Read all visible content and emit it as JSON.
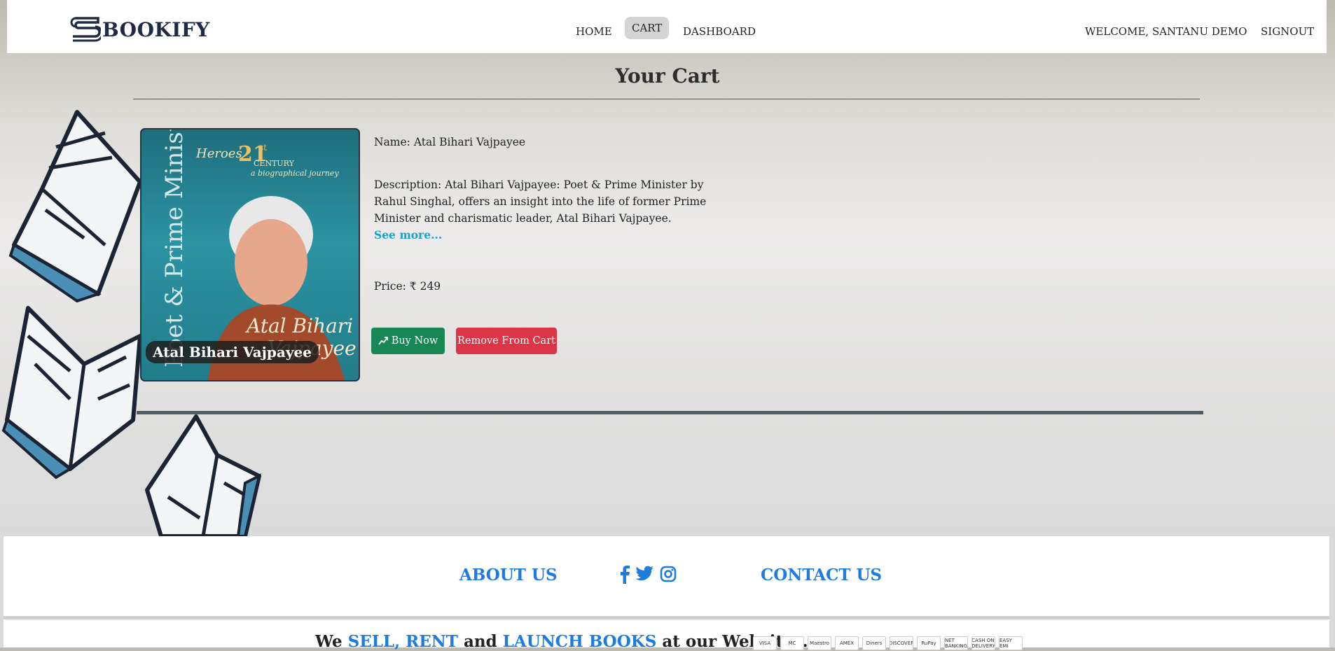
{
  "brand": {
    "name": "BOOKIFY"
  },
  "nav": {
    "home": "HOME",
    "cart": "CART",
    "dashboard": "DASHBOARD",
    "welcome": "WELCOME, SANTANU DEMO",
    "signout": "SIGNOUT"
  },
  "cart": {
    "title": "Your Cart",
    "item": {
      "cover_label": "Atal Bihari Vajpayee",
      "name_line": "Name: Atal Bihari Vajpayee",
      "description": "Description: Atal Bihari Vajpayee: Poet & Prime Minister by Rahul Singhal, offers an insight into the life of former Prime Minister and charismatic leader, Atal Bihari Vajpayee.",
      "see_more": "See more...",
      "price_line": "Price: ₹ 249",
      "buy_label": "Buy Now",
      "remove_label": "Remove From Cart"
    }
  },
  "footer": {
    "about": "ABOUT US",
    "contact": "CONTACT US",
    "social_icons": [
      "facebook-icon",
      "twitter-icon",
      "instagram-icon"
    ],
    "tagline_we": "We",
    "tagline_sell": "SELL,",
    "tagline_rent": "RENT",
    "tagline_and": "and",
    "tagline_launch": "LAUNCH BOOKS",
    "tagline_rest": "at our Websites...",
    "payment_methods": [
      "VISA",
      "MC",
      "Maestro",
      "AMEX",
      "Diners",
      "DISCOVER",
      "RuPay",
      "NET BANKING",
      "CASH ON DELIVERY",
      "EASY EMI"
    ]
  },
  "colors": {
    "accent": "#1e7be0",
    "buy": "#198754",
    "remove": "#dc3545",
    "link": "#1ea0c8"
  }
}
